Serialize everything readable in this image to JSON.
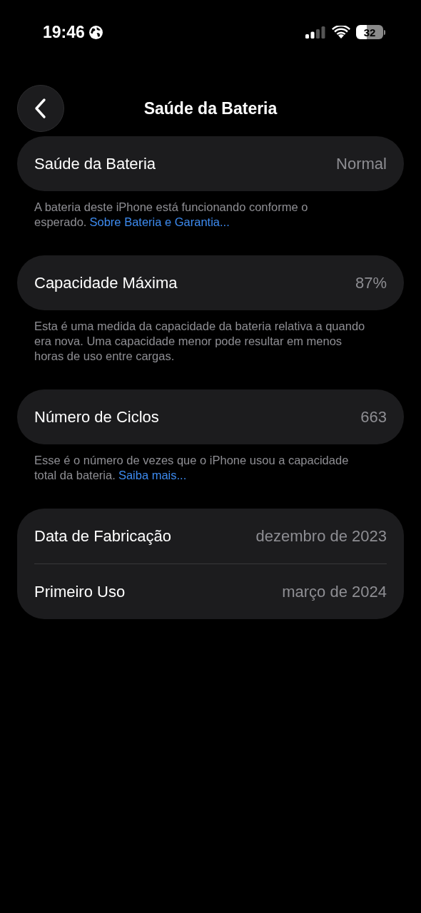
{
  "status_bar": {
    "time": "19:46",
    "battery": "32"
  },
  "nav": {
    "title": "Saúde da Bateria"
  },
  "groups": [
    {
      "rows": [
        {
          "label": "Saúde da Bateria",
          "value": "Normal"
        }
      ],
      "footnote": {
        "text": "A bateria deste iPhone está funcionando conforme o esperado.",
        "link": "Sobre Bateria e Garantia..."
      }
    },
    {
      "rows": [
        {
          "label": "Capacidade Máxima",
          "value": "87%"
        }
      ],
      "footnote": {
        "text": "Esta é uma medida da capacidade da bateria relativa a quando era nova. Uma capacidade menor pode resultar em menos horas de uso entre cargas."
      }
    },
    {
      "rows": [
        {
          "label": "Número de Ciclos",
          "value": "663"
        }
      ],
      "footnote": {
        "text": "Esse é o número de vezes que o iPhone usou a capacidade total da bateria.",
        "link": "Saiba mais..."
      }
    },
    {
      "rows": [
        {
          "label": "Data de Fabricação",
          "value": "dezembro de 2023"
        },
        {
          "label": "Primeiro Uso",
          "value": "março de 2024"
        }
      ]
    }
  ]
}
